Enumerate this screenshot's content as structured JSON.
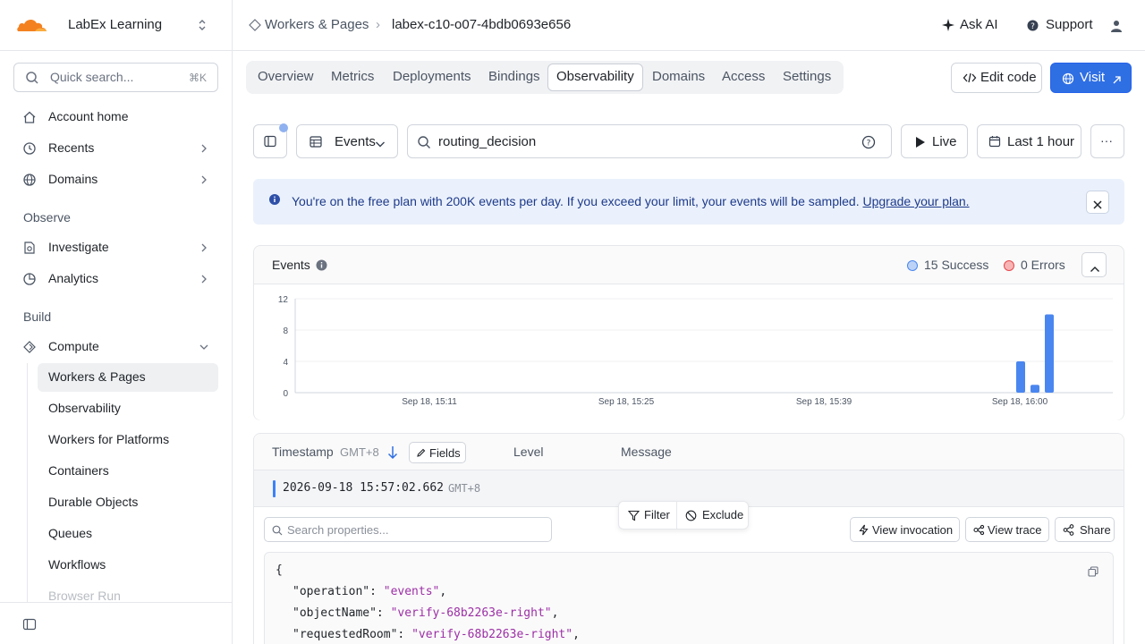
{
  "account": {
    "name": "LabEx Learning"
  },
  "search": {
    "placeholder": "Quick search...",
    "shortcut": "⌘K"
  },
  "sidebar": {
    "top_items": [
      {
        "label": "Account home"
      },
      {
        "label": "Recents"
      },
      {
        "label": "Domains"
      }
    ],
    "observe_header": "Observe",
    "observe_items": [
      {
        "label": "Investigate"
      },
      {
        "label": "Analytics"
      }
    ],
    "build_header": "Build",
    "compute": {
      "label": "Compute"
    },
    "compute_items": [
      {
        "label": "Workers & Pages"
      },
      {
        "label": "Observability"
      },
      {
        "label": "Workers for Platforms"
      },
      {
        "label": "Containers"
      },
      {
        "label": "Durable Objects"
      },
      {
        "label": "Queues"
      },
      {
        "label": "Workflows"
      },
      {
        "label": "Browser Run"
      }
    ]
  },
  "breadcrumb": {
    "parent": "Workers & Pages",
    "current": "labex-c10-o07-4bdb0693e656"
  },
  "header": {
    "ask_ai": "Ask AI",
    "support": "Support"
  },
  "tabs": [
    "Overview",
    "Metrics",
    "Deployments",
    "Bindings",
    "Observability",
    "Domains",
    "Access",
    "Settings"
  ],
  "actions": {
    "edit_code": "Edit code",
    "visit": "Visit"
  },
  "toolbar": {
    "view_select": "Events",
    "query": "routing_decision",
    "live": "Live",
    "time_range": "Last 1 hour",
    "more": "···"
  },
  "banner": {
    "message": "You're on the free plan with 200K events per day. If you exceed your limit, your events will be sampled.",
    "link": "Upgrade your plan."
  },
  "events_card": {
    "title": "Events",
    "success_label": "15 Success",
    "errors_label": "0 Errors",
    "colors": {
      "success": "#4a86f0",
      "error": "#e5484d"
    }
  },
  "chart_data": {
    "type": "bar",
    "title": "Events",
    "xlabel": "",
    "ylabel": "",
    "ylim": [
      0,
      12
    ],
    "yticks": [
      0,
      4,
      8,
      12
    ],
    "xtick_labels": [
      "Sep 18, 15:11",
      "Sep 18, 15:25",
      "Sep 18, 15:39",
      "Sep 18, 16:00"
    ],
    "series": [
      {
        "name": "Success",
        "x": [
          "Sep 18, 15:57",
          "Sep 18, 15:58",
          "Sep 18, 15:59"
        ],
        "values": [
          4,
          1,
          10
        ]
      },
      {
        "name": "Errors",
        "x": [],
        "values": []
      }
    ],
    "grid": true,
    "legend": "top-right"
  },
  "table": {
    "columns": {
      "timestamp": "Timestamp",
      "tz": "GMT+8",
      "fields": "Fields",
      "level": "Level",
      "message": "Message"
    },
    "row": {
      "timestamp": "2026-09-18 15:57:02.662",
      "tz": "GMT+8"
    },
    "popover": {
      "filter": "Filter",
      "exclude": "Exclude"
    },
    "property_search_placeholder": "Search properties...",
    "buttons": {
      "view_invocation": "View invocation",
      "view_trace": "View trace",
      "share": "Share"
    },
    "json_lines": [
      {
        "key": "",
        "value": "",
        "raw": "{"
      },
      {
        "key": "\"operation\": ",
        "value": "\"events\"",
        "raw": ""
      },
      {
        "key": "\"objectName\": ",
        "value": "\"verify-68b2263e-right\"",
        "raw": ""
      },
      {
        "key": "\"requestedRoom\": ",
        "value": "\"verify-68b2263e-right\"",
        "raw": ""
      }
    ]
  }
}
